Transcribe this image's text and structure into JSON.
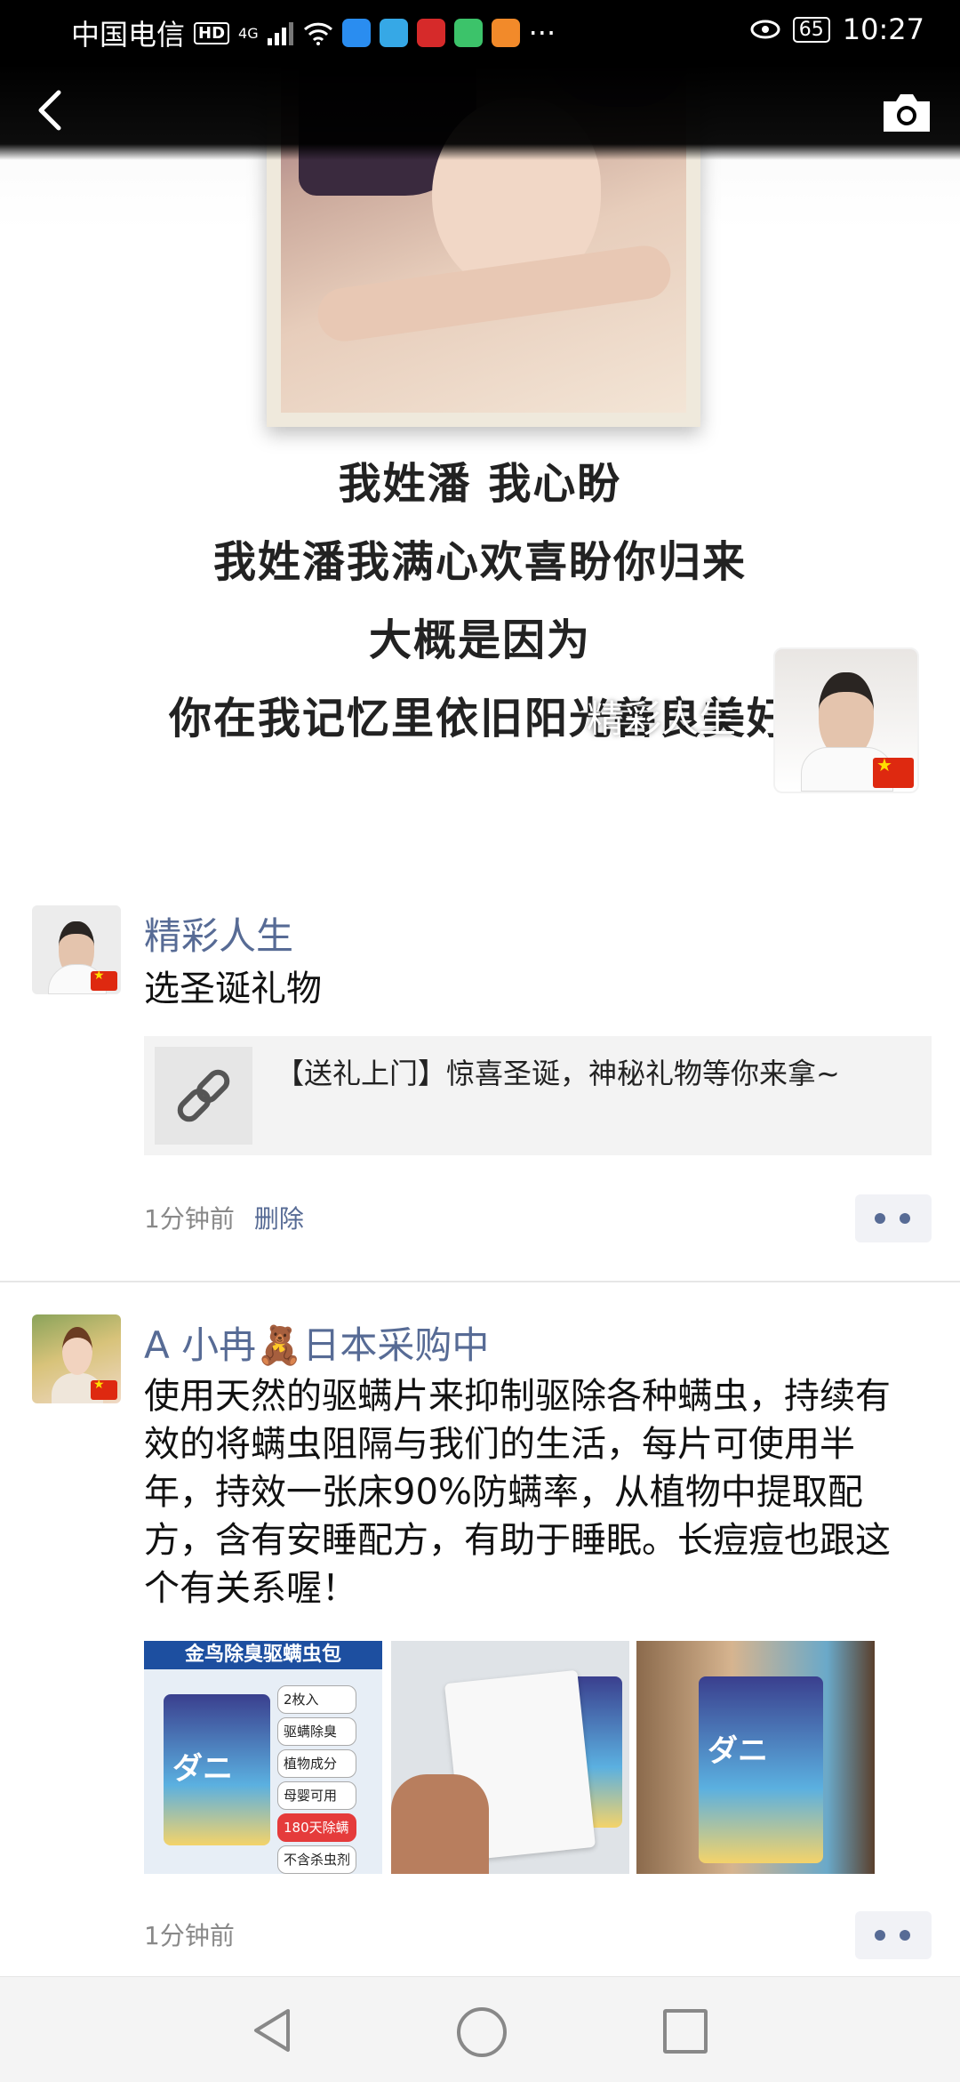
{
  "status_bar": {
    "carrier": "中国电信",
    "hd": "HD",
    "network": "4G",
    "more_dots": "···",
    "battery": "65",
    "time": "10:27"
  },
  "cover": {
    "lines": [
      "我姓潘  我心盼",
      "我姓潘我满心欢喜盼你归来",
      "大概是因为",
      "你在我记忆里依旧阳光善良美好"
    ],
    "owner_name": "精彩人生"
  },
  "posts": [
    {
      "author": "精彩人生",
      "text": "选圣诞礼物",
      "link_title": "【送礼上门】惊喜圣诞，神秘礼物等你来拿~",
      "time": "1分钟前",
      "delete_label": "删除"
    },
    {
      "author": "A 小冉🧸日本采购中",
      "text": "使用天然的驱螨片来抑制驱除各种螨虫，持续有效的将螨虫阻隔与我们的生活，每片可使用半年，持效一张床90%防螨率，从植物中提取配方，含有安睡配方，有助于睡眠。长痘痘也跟这个有关系喔！",
      "image1_title": "金鸟除臭驱螨虫包",
      "image1_tags": [
        "2枚入",
        "驱螨除臭",
        "植物成分",
        "母婴可用",
        "180天除螨",
        "不含杀虫剂"
      ],
      "time": "1分钟前"
    }
  ],
  "icons": {
    "back": "chevron-left-icon",
    "camera": "camera-icon",
    "link": "link-icon",
    "more": "more-dots-icon"
  },
  "colors": {
    "nickname": "#576b95",
    "meta": "#888888",
    "status_bg": "#000000"
  }
}
